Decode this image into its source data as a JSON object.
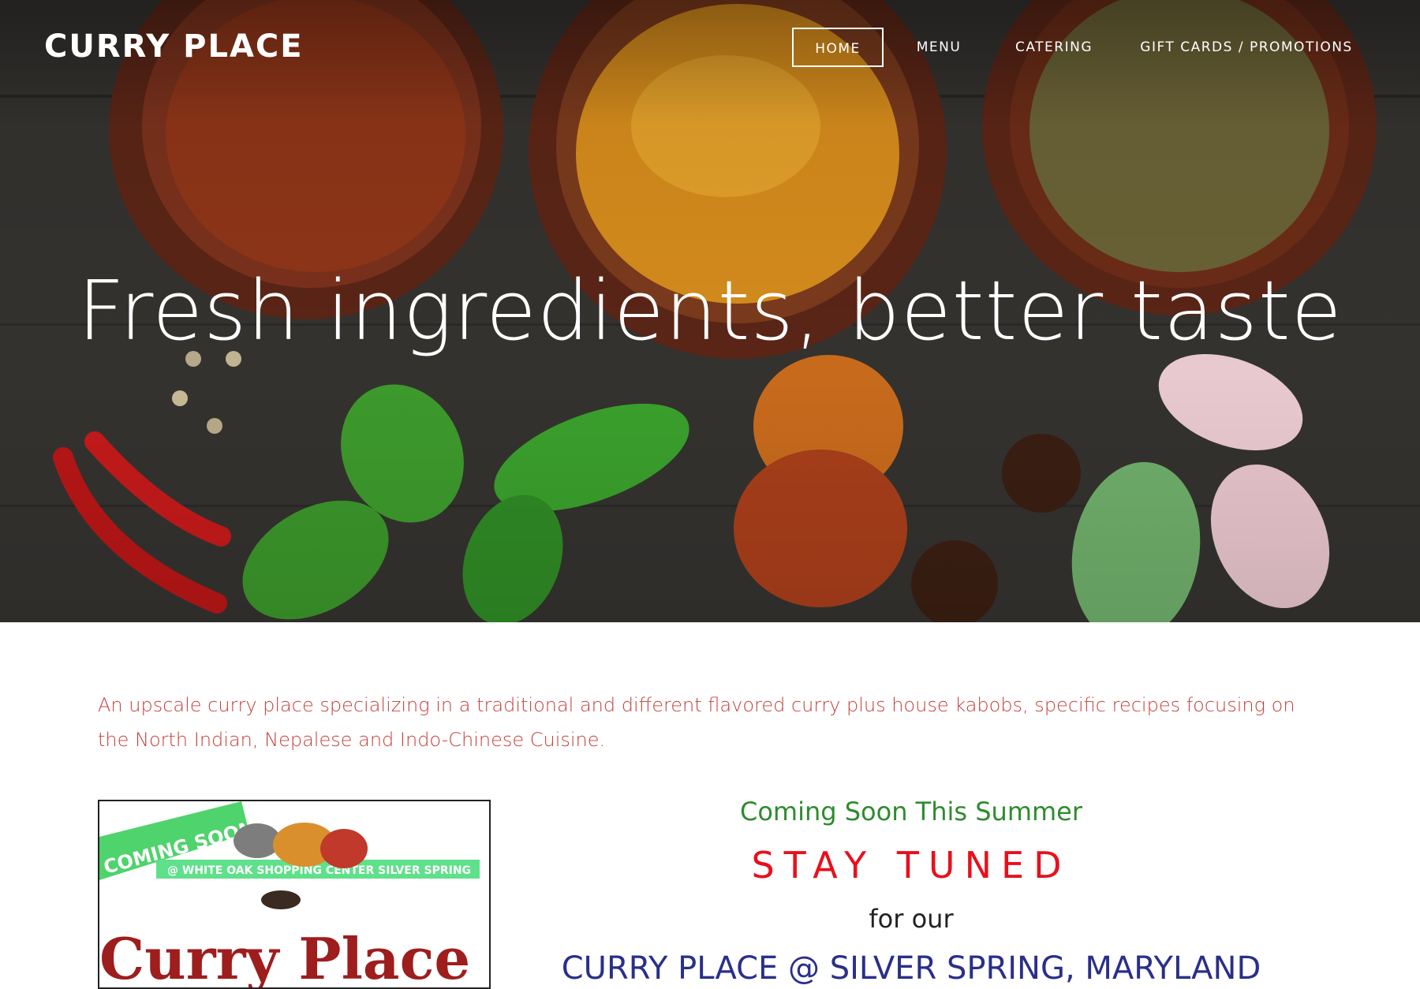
{
  "header": {
    "brand": "CURRY PLACE",
    "nav": [
      {
        "label": "HOME",
        "active": true
      },
      {
        "label": "MENU",
        "active": false
      },
      {
        "label": "CATERING",
        "active": false
      },
      {
        "label": "GIFT CARDS / PROMOTIONS",
        "active": false
      }
    ]
  },
  "hero": {
    "title": "Fresh ingredients, better taste"
  },
  "main": {
    "intro": "An upscale curry place specializing in a traditional and different flavored curry plus house kabobs, specific recipes focusing on the North Indian, Nepalese and Indo-Chinese Cuisine.",
    "promo_image": {
      "banner_text": "COMING SOON",
      "sub_text": "@ WHITE OAK SHOPPING CENTER SILVER SPRING",
      "logo_text": "Curry Place"
    },
    "coming_soon": "Coming Soon This Summer",
    "stay_tuned": "STAY TUNED",
    "for_our": "for our",
    "location": "CURRY PLACE @ SILVER SPRING, MARYLAND"
  },
  "colors": {
    "intro_text": "#c4403a",
    "coming_soon": "#2e8b2e",
    "stay_tuned": "#e8101c",
    "location": "#2a2f8a"
  }
}
